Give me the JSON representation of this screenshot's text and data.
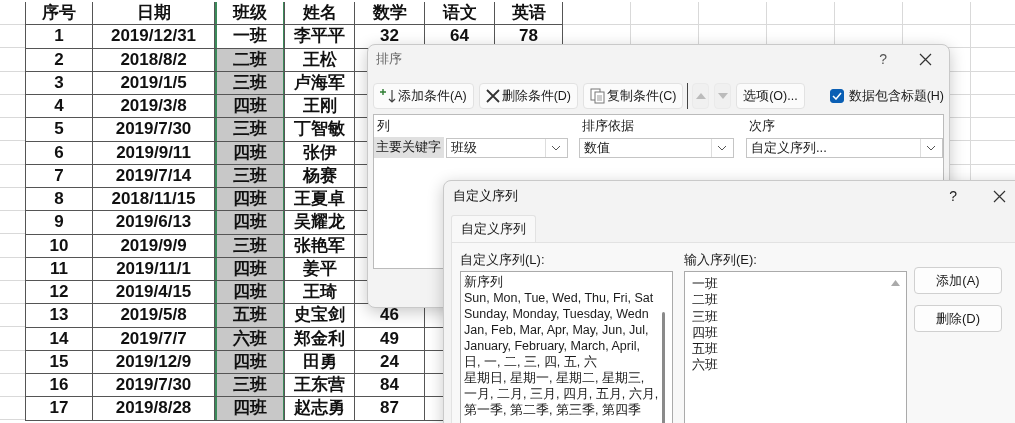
{
  "sheet": {
    "columns": [
      {
        "label": "序号",
        "selected": false
      },
      {
        "label": "日期",
        "selected": false
      },
      {
        "label": "班级",
        "selected": true
      },
      {
        "label": "姓名",
        "selected": false
      },
      {
        "label": "数学",
        "selected": false
      },
      {
        "label": "语文",
        "selected": false
      },
      {
        "label": "英语",
        "selected": false
      }
    ],
    "rows": [
      [
        "1",
        "2019/12/31",
        "一班",
        "李平平",
        "32",
        "64",
        "78"
      ],
      [
        "2",
        "2018/8/2",
        "二班",
        "王松"
      ],
      [
        "3",
        "2019/1/5",
        "三班",
        "卢海军"
      ],
      [
        "4",
        "2019/3/8",
        "四班",
        "王刚"
      ],
      [
        "5",
        "2019/7/30",
        "三班",
        "丁智敏"
      ],
      [
        "6",
        "2019/9/11",
        "四班",
        "张伊"
      ],
      [
        "7",
        "2019/7/14",
        "三班",
        "杨赛"
      ],
      [
        "8",
        "2018/11/15",
        "四班",
        "王夏卓"
      ],
      [
        "9",
        "2019/6/13",
        "四班",
        "吴耀龙"
      ],
      [
        "10",
        "2019/9/9",
        "三班",
        "张艳军"
      ],
      [
        "11",
        "2019/11/1",
        "四班",
        "姜平"
      ],
      [
        "12",
        "2019/4/15",
        "四班",
        "王琦"
      ],
      [
        "13",
        "2019/5/8",
        "五班",
        "史宝剑",
        "46"
      ],
      [
        "14",
        "2019/7/7",
        "六班",
        "郑金利",
        "49"
      ],
      [
        "15",
        "2019/12/9",
        "四班",
        "田勇",
        "24"
      ],
      [
        "16",
        "2019/7/30",
        "三班",
        "王东营",
        "84"
      ],
      [
        "17",
        "2019/8/28",
        "四班",
        "赵志勇",
        "87"
      ]
    ]
  },
  "sort_dialog": {
    "title": "排序",
    "help": "?",
    "toolbar": [
      {
        "kind": "add",
        "label": "添加条件(A)",
        "disabled": false
      },
      {
        "kind": "delete",
        "label": "删除条件(D)",
        "disabled": false
      },
      {
        "kind": "copy",
        "label": "复制条件(C)",
        "disabled": false
      },
      {
        "kind": "up",
        "disabled": true
      },
      {
        "kind": "down",
        "disabled": true
      },
      {
        "kind": "options",
        "label": "选项(O)...",
        "disabled": false
      }
    ],
    "header_checkbox": {
      "label": "数据包含标题(H)",
      "checked": true
    },
    "grid": {
      "columns": [
        "列",
        "排序依据",
        "次序"
      ],
      "rows": [
        {
          "label": "主要关键字",
          "column": "班级",
          "sort_on": "数值",
          "order": "自定义序列..."
        }
      ]
    }
  },
  "custom_lists_dialog": {
    "title": "自定义序列",
    "help": "?",
    "tabs": [
      {
        "label": "自定义序列",
        "selected": true
      }
    ],
    "lists_label": "自定义序列(L):",
    "lists": [
      "新序列",
      "Sun, Mon, Tue, Wed, Thu, Fri, Sat",
      "Sunday, Monday, Tuesday, Wedn",
      "Jan, Feb, Mar, Apr, May, Jun, Jul,",
      "January, February, March, April,",
      "日, 一, 二, 三, 四, 五, 六",
      "星期日, 星期一, 星期二, 星期三,",
      "一月, 二月, 三月, 四月, 五月, 六月,",
      "第一季, 第二季, 第三季, 第四季"
    ],
    "entries_label": "输入序列(E):",
    "entries": [
      "一班",
      "二班",
      "三班",
      "四班",
      "五班",
      "六班"
    ],
    "buttons": [
      "添加(A)",
      "删除(D)"
    ]
  }
}
